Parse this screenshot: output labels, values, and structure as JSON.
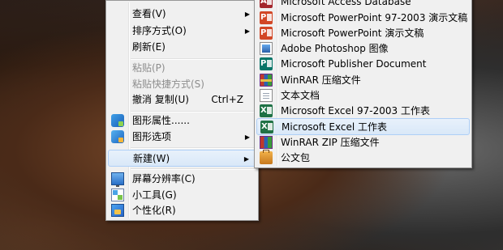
{
  "context_menu": {
    "items": [
      {
        "label": "查看(V)"
      },
      {
        "label": "排序方式(O)"
      },
      {
        "label": "刷新(E)"
      },
      {
        "label": "粘贴(P)"
      },
      {
        "label": "粘贴快捷方式(S)"
      },
      {
        "label": "撤消 复制(U)",
        "shortcut": "Ctrl+Z"
      },
      {
        "label": "图形属性......"
      },
      {
        "label": "图形选项"
      },
      {
        "label": "新建(W)"
      },
      {
        "label": "屏幕分辨率(C)"
      },
      {
        "label": "小工具(G)"
      },
      {
        "label": "个性化(R)"
      }
    ]
  },
  "new_submenu": {
    "items": [
      {
        "label": "Microsoft Access Database",
        "icon": "access-icon"
      },
      {
        "label": "Microsoft PowerPoint 97-2003 演示文稿",
        "icon": "powerpoint-icon"
      },
      {
        "label": "Microsoft PowerPoint 演示文稿",
        "icon": "powerpoint-icon"
      },
      {
        "label": "Adobe Photoshop 图像",
        "icon": "photoshop-icon"
      },
      {
        "label": "Microsoft Publisher Document",
        "icon": "publisher-icon"
      },
      {
        "label": "WinRAR 压缩文件",
        "icon": "winrar-icon"
      },
      {
        "label": "文本文档",
        "icon": "text-document-icon"
      },
      {
        "label": "Microsoft Excel 97-2003 工作表",
        "icon": "excel-icon"
      },
      {
        "label": "Microsoft Excel 工作表",
        "icon": "excel-icon"
      },
      {
        "label": "WinRAR ZIP 压缩文件",
        "icon": "winrar-zip-icon"
      },
      {
        "label": "公文包",
        "icon": "briefcase-icon"
      }
    ]
  },
  "colors": {
    "menu_background": "#f0f0f0",
    "menu_border": "#979797",
    "hover_background": "#d9e8f8",
    "hover_border": "#aecff7",
    "disabled_text": "#8d8d8d"
  }
}
